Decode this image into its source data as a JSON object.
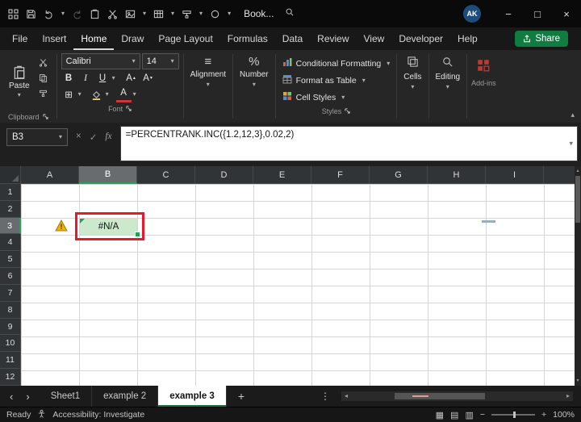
{
  "titlebar": {
    "workbook_name": "Book...",
    "avatar_initials": "AK",
    "minimize_glyph": "−",
    "maximize_glyph": "□",
    "close_glyph": "×"
  },
  "menu": {
    "items": [
      "File",
      "Insert",
      "Home",
      "Draw",
      "Page Layout",
      "Formulas",
      "Data",
      "Review",
      "View",
      "Developer",
      "Help"
    ],
    "active_item": "Home",
    "share_label": "Share"
  },
  "ribbon": {
    "paste_label": "Paste",
    "font_name": "Calibri",
    "font_size": "14",
    "bold_glyph": "B",
    "italic_glyph": "I",
    "underline_glyph": "U",
    "grow_font_glyph": "A",
    "shrink_font_glyph": "A",
    "font_color_glyph": "A",
    "borders_glyph": "⊞",
    "align_glyph": "≡",
    "percent_glyph": "%",
    "alignment_label": "Alignment",
    "number_label": "Number",
    "conditional_formatting_label": "Conditional Formatting",
    "format_as_table_label": "Format as Table",
    "cell_styles_label": "Cell Styles",
    "cells_label": "Cells",
    "editing_label": "Editing",
    "group_labels": {
      "clipboard": "Clipboard",
      "font": "Font",
      "styles": "Styles",
      "addins": "Add-ins"
    }
  },
  "formula_bar": {
    "name_box_value": "B3",
    "cancel_glyph": "×",
    "enter_glyph": "✓",
    "fx_label": "fx",
    "formula": "=PERCENTRANK.INC({1.2,12,3},0.02,2)"
  },
  "grid": {
    "column_headers": [
      "A",
      "B",
      "C",
      "D",
      "E",
      "F",
      "G",
      "H",
      "I"
    ],
    "row_headers": [
      "1",
      "2",
      "3",
      "4",
      "5",
      "6",
      "7",
      "8",
      "9",
      "10",
      "11",
      "12"
    ],
    "selected_column": "B",
    "selected_row": "3",
    "active_cell": {
      "ref": "B3",
      "value": "#N/A"
    }
  },
  "sheet_tabs": {
    "tabs": [
      "Sheet1",
      "example 2",
      "example 3"
    ],
    "active_tab": "example 3",
    "add_glyph": "+",
    "menu_glyph": "⋮",
    "nav_left_glyph": "‹",
    "nav_right_glyph": "›",
    "scroll_left_glyph": "◂",
    "scroll_right_glyph": "▸"
  },
  "status_bar": {
    "mode": "Ready",
    "accessibility_text": "Accessibility: Investigate",
    "view_normal_glyph": "▦",
    "view_layout_glyph": "▤",
    "view_break_glyph": "▥",
    "zoom_out_glyph": "−",
    "zoom_in_glyph": "+",
    "zoom_level": "100%"
  },
  "icons": {
    "chevron_down": "▾",
    "chevron_up": "▴"
  },
  "colors": {
    "accent_green": "#107c41",
    "annotation_red": "#e8192d",
    "cell_fill_green": "#cde9cd",
    "warning_yellow": "#f0b000",
    "titlebar_black": "#0a0a0a",
    "ribbon_gray": "#262626"
  }
}
